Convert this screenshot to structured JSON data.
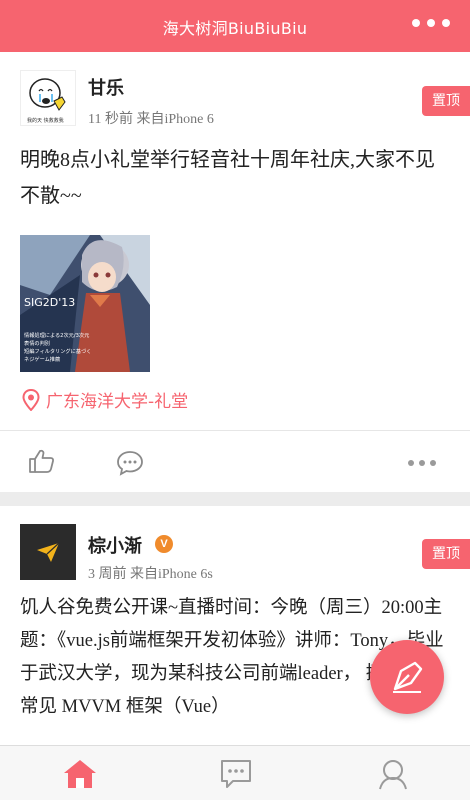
{
  "header": {
    "title": "海大树洞BiuBiuBiu",
    "menu_icon": "more-horizontal-icon"
  },
  "posts": [
    {
      "user": "甘乐",
      "meta": "11 秒前 来自iPhone 6",
      "pinned_label": "置顶",
      "content": "明晚8点小礼堂举行轻音社十周年社庆,大家不见不散~~",
      "avatar_text": "我的天 快救救我",
      "image_texts": {
        "headline": "SIG2D'13",
        "line1": "情報処理による2次元/3次元",
        "line2": "表情の判別",
        "line3": "短編フィルタリングに基づく",
        "line4": "ネジゲーム推薦"
      },
      "location": "广东海洋大学-礼堂"
    },
    {
      "user": "棕小渐",
      "verified": "V",
      "meta": "3 周前 来自iPhone 6s",
      "pinned_label": "置顶",
      "content": "饥人谷免费公开课~直播时间：今晚（周三）20:00主题：《vue.js前端框架开发初体验》讲师：Tony，毕业于武汉大学，现为某科技公司前端leader， 擅长前端常见 MVVM 框架（Vue）"
    }
  ],
  "tabs": [
    {
      "name": "home",
      "icon": "home-icon",
      "active": true
    },
    {
      "name": "messages",
      "icon": "message-icon",
      "active": false
    },
    {
      "name": "profile",
      "icon": "user-icon",
      "active": false
    }
  ],
  "colors": {
    "accent": "#f6646f",
    "muted": "#9a9a9a",
    "verified": "#f08b2c"
  }
}
